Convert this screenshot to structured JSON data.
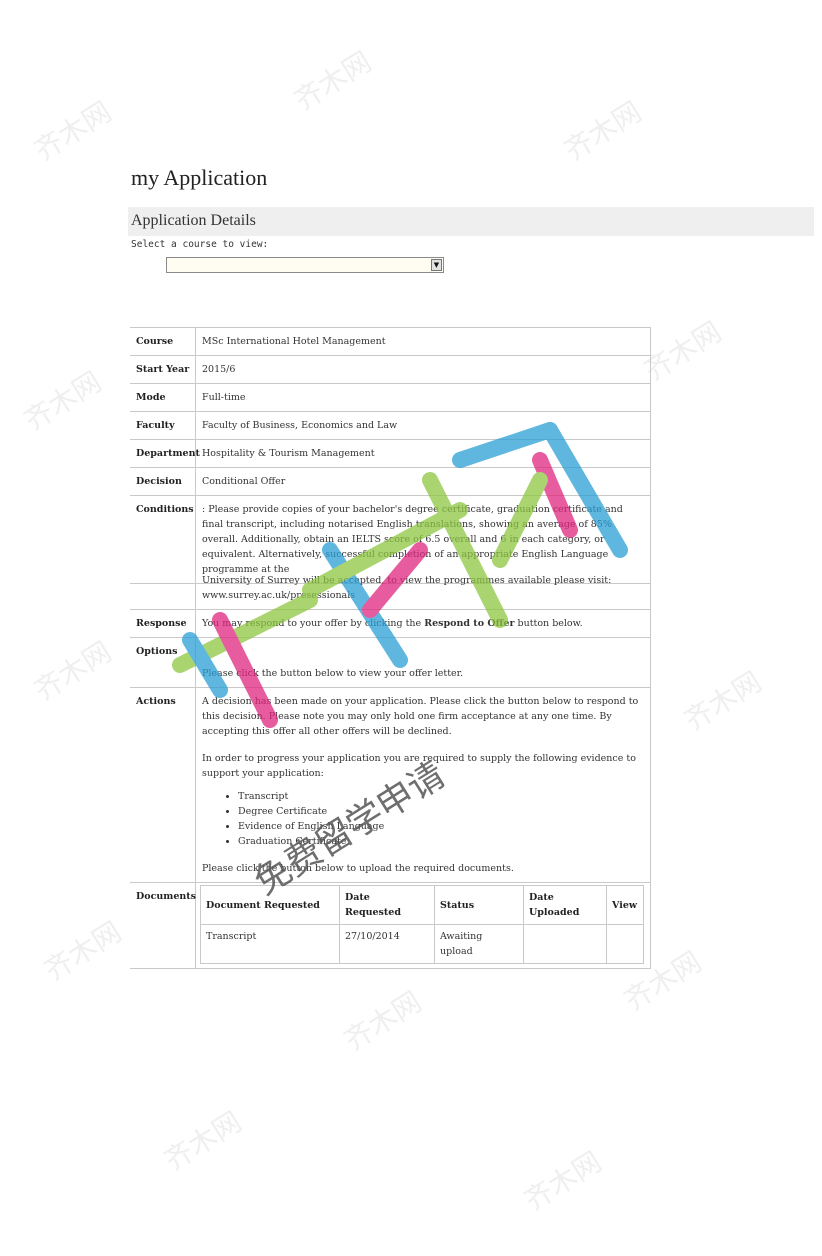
{
  "page": {
    "title": "my Application"
  },
  "section": {
    "title": "Application Details",
    "select_label": "Select a course to view:",
    "select_value": ""
  },
  "details": {
    "course": {
      "label": "Course",
      "value": "MSc International Hotel Management"
    },
    "start_year": {
      "label": "Start Year",
      "value": "2015/6"
    },
    "mode": {
      "label": "Mode",
      "value": "Full-time"
    },
    "faculty": {
      "label": "Faculty",
      "value": "Faculty of Business, Economics and Law"
    },
    "department": {
      "label": "Department",
      "value": "Hospitality & Tourism Management"
    },
    "decision": {
      "label": "Decision",
      "value": "Conditional Offer"
    },
    "conditions": {
      "label": "Conditions",
      "value": ": Please provide copies of your bachelor's degree certificate, graduation certificate and final transcript, including notarised English translations, showing an average of 85% overall. Additionally, obtain an IELTS score of 6.5 overall and 6 in each category, or equivalent. Alternatively, successful completion of an appropriate English Language programme at the",
      "continued": "University of Surrey will be accepted, to view the programmes available please visit: www.surrey.ac.uk/presessionals"
    },
    "response": {
      "label": "Response",
      "pre": "You may respond to your offer by clicking the",
      "button_name": "Respond to Offer",
      "post": "button below."
    },
    "options": {
      "label": "Options",
      "text": "Please click the button below to view your offer letter."
    },
    "actions": {
      "label": "Actions",
      "text1": "A decision has been made on your application. Please click the button below to respond to this decision. Please note you may only hold one firm acceptance at any one time. By accepting this offer all other offers will be declined.",
      "text2": "In order to progress your application you are required to supply the following evidence to support your application:",
      "evidence": [
        "Transcript",
        "Degree Certificate",
        "Evidence of English Language",
        "Graduation Certificate"
      ],
      "text3": "Please click the button below to upload the required documents."
    },
    "documents": {
      "label": "Documents",
      "headers": [
        "Document Requested",
        "Date Requested",
        "Status",
        "Date Uploaded",
        "View"
      ],
      "rows": [
        [
          "Transcript",
          "27/10/2014",
          "Awaiting upload",
          "",
          ""
        ]
      ]
    }
  },
  "watermark": {
    "logo_text": "齐木网",
    "tagline": "免费留学申请",
    "tile_text": "齐木网"
  }
}
